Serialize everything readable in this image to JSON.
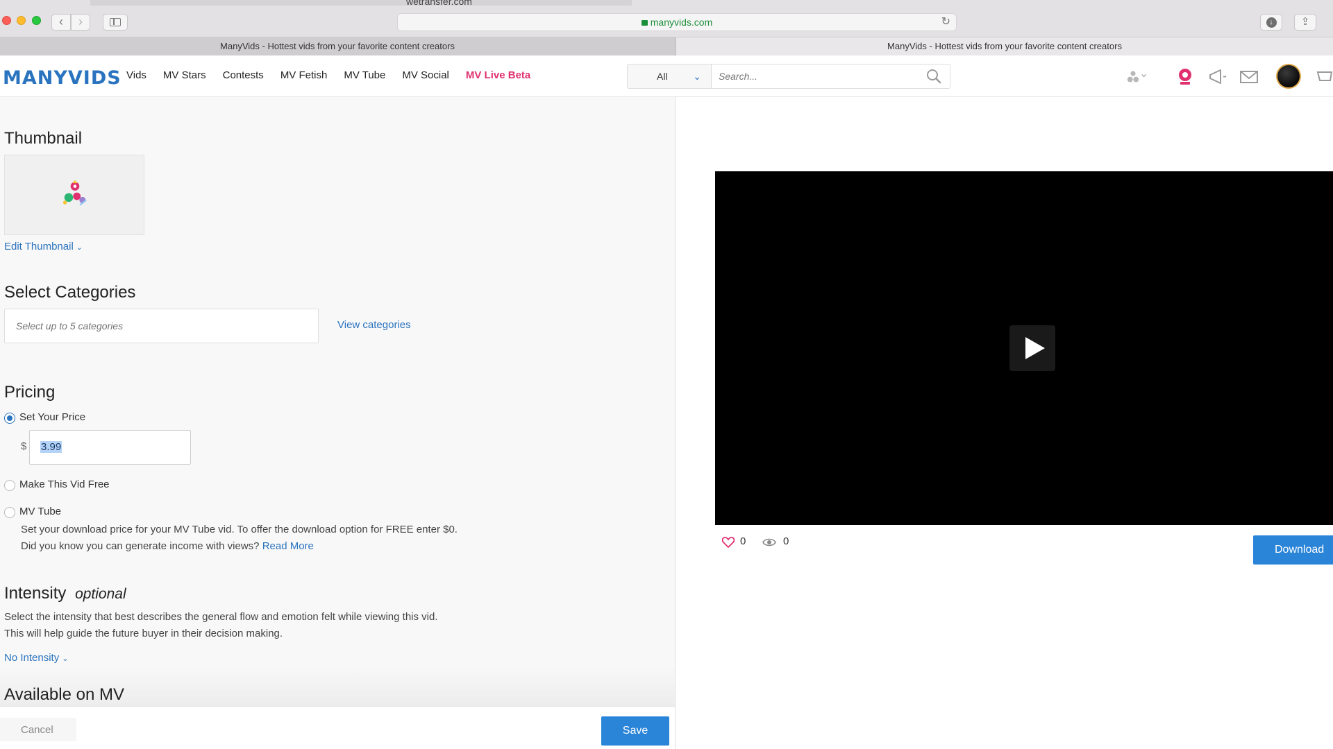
{
  "browser": {
    "ghost_url": "wetransfer.com",
    "address": "manyvids.com",
    "tabs": [
      "ManyVids - Hottest vids from your favorite content creators",
      "ManyVids - Hottest vids from your favorite content creators"
    ]
  },
  "site": {
    "logo": "MANYVIDS",
    "nav": [
      "Vids",
      "MV Stars",
      "Contests",
      "MV Fetish",
      "MV Tube",
      "MV Social",
      "MV Live Beta"
    ],
    "search_scope": "All",
    "search_placeholder": "Search..."
  },
  "editor": {
    "thumbnail_title": "Thumbnail",
    "edit_thumbnail": "Edit Thumbnail",
    "categories_title": "Select Categories",
    "categories_placeholder": "Select up to 5 categories",
    "view_categories": "View categories",
    "pricing_title": "Pricing",
    "pricing_options": [
      "Set Your Price",
      "Make This Vid Free",
      "MV Tube"
    ],
    "selected_pricing_option": "Set Your Price",
    "currency_symbol": "$",
    "price_value": "3.99",
    "tube_note_line1": "Set your download price for your MV Tube vid. To offer the download option for FREE enter $0.",
    "tube_note_line2": "Did you know you can generate income with views?",
    "read_more": "Read More",
    "intensity_title": "Intensity",
    "intensity_optional": "optional",
    "intensity_desc_line1": "Select the intensity that best describes the general flow and emotion felt while viewing this vid.",
    "intensity_desc_line2": "This will help guide the future buyer in their decision making.",
    "intensity_value": "No Intensity",
    "available_title": "Available on MV",
    "cancel": "Cancel",
    "save": "Save"
  },
  "preview": {
    "likes": "0",
    "views": "0",
    "download": "Download"
  },
  "colors": {
    "brand_blue": "#2a73bf",
    "live_pink": "#e0306f",
    "button_blue": "#2a84d8"
  }
}
